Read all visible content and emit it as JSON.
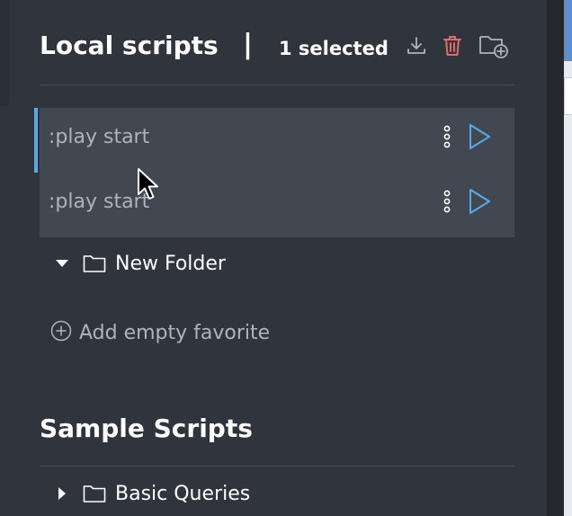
{
  "header": {
    "title": "Local scripts",
    "separator": "|",
    "selected_text": "1 selected",
    "icons": {
      "download": "download-icon",
      "delete": "trash-icon",
      "new_folder": "folder-plus-icon"
    },
    "colors": {
      "delete": "#e06c6c",
      "icon": "#aeb4bd"
    }
  },
  "local_scripts": [
    {
      "label": ":play start",
      "selected": true
    },
    {
      "label": ":play start",
      "selected": true
    }
  ],
  "folder": {
    "label": "New Folder",
    "expanded": true
  },
  "add_favorite": {
    "label": "Add empty favorite"
  },
  "sample_scripts": {
    "title": "Sample Scripts",
    "folders": [
      {
        "label": "Basic Queries",
        "expanded": false
      }
    ]
  },
  "colors": {
    "panel_bg": "#30343c",
    "selected_row_bg": "#424852",
    "accent": "#5aa9e6",
    "text_primary": "#ffffff",
    "text_muted": "#aeb4bd"
  }
}
